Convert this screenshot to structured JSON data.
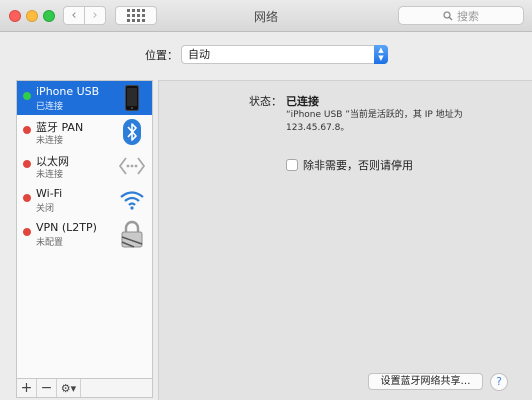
{
  "window": {
    "title": "网络",
    "search_placeholder": "搜索",
    "nav_back": "‹",
    "nav_forward": "›"
  },
  "location": {
    "label": "位置：",
    "value": "自动"
  },
  "sidebar": {
    "items": [
      {
        "name": "iPhone USB",
        "status": "已连接",
        "state": "green",
        "icon": "iphone-icon",
        "selected": true
      },
      {
        "name": "蓝牙 PAN",
        "status": "未连接",
        "state": "red",
        "icon": "bluetooth-icon",
        "selected": false
      },
      {
        "name": "以太网",
        "status": "未连接",
        "state": "red",
        "icon": "ethernet-icon",
        "selected": false
      },
      {
        "name": "Wi-Fi",
        "status": "关闭",
        "state": "red",
        "icon": "wifi-icon",
        "selected": false
      },
      {
        "name": "VPN (L2TP)",
        "status": "未配置",
        "state": "red",
        "icon": "vpn-lock-icon",
        "selected": false
      }
    ],
    "footer": {
      "add": "+",
      "remove": "−",
      "gear": "⚙▾"
    }
  },
  "detail": {
    "status_label": "状态：",
    "status_value": "已连接",
    "status_description": "“iPhone USB ”当前是活跃的，其 IP 地址为 123.45.67.8。",
    "checkbox_label": "除非需要，否则请停用",
    "checkbox_checked": false,
    "share_button": "设置蓝牙网络共享…",
    "help": "?"
  },
  "colors": {
    "selection": "#1e6fd9",
    "connected": "#2fcd4a",
    "disconnected": "#e0463e"
  }
}
